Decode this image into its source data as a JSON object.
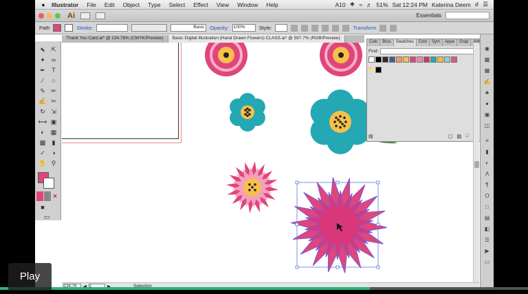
{
  "menubar": {
    "apple": "",
    "app_name": "Illustrator",
    "items": [
      "File",
      "Edit",
      "Object",
      "Type",
      "Select",
      "Effect",
      "View",
      "Window",
      "Help"
    ],
    "status": {
      "wifi": "",
      "battery": "51%",
      "datetime": "Sat 12:24 PM",
      "user": "Katerina Deem",
      "ai_badge": "10"
    }
  },
  "appbar": {
    "logo": "Ai",
    "workspace": "Essentials"
  },
  "controlbar": {
    "path_label": "Path",
    "stroke_label": "Stroke:",
    "basic_label": "Basic",
    "opacity_label": "Opacity:",
    "opacity_value": "100%",
    "style_label": "Style:",
    "transform_label": "Transform"
  },
  "tabs": [
    {
      "label": "Thank You Card.ai* @ 134.76% (CMYK/Preview)"
    },
    {
      "label": "Basic Digital Illustration (Hand Drawn Flowers) CLASS.ai* @ 597.7% (RGB/Preview)"
    }
  ],
  "swatches_panel": {
    "tabs": [
      "Colo",
      "Brus",
      "Swatches",
      "Colo",
      "Sym",
      "Appe",
      "Grap",
      "Artb"
    ],
    "find_label": "Find:",
    "colors": [
      "#ffffff",
      "#000000",
      "#2e2e2e",
      "#45608a",
      "#f19a5a",
      "#f3c04a",
      "#e0457b",
      "#ee8ab0",
      "#c93b6e",
      "#24a8b3",
      "#f6b93b",
      "#8fcfd6",
      "#e05a7a"
    ]
  },
  "status": {
    "zoom": "134.76",
    "artboard": "1",
    "tool": "Selection"
  },
  "overlay": {
    "play_label": "Play",
    "progress": 0.7
  },
  "colors": {
    "pink": "#e0457b",
    "teal": "#24a8b3",
    "yellow": "#f6c04a",
    "leaf": "#4f8a52",
    "dark": "#222222"
  }
}
